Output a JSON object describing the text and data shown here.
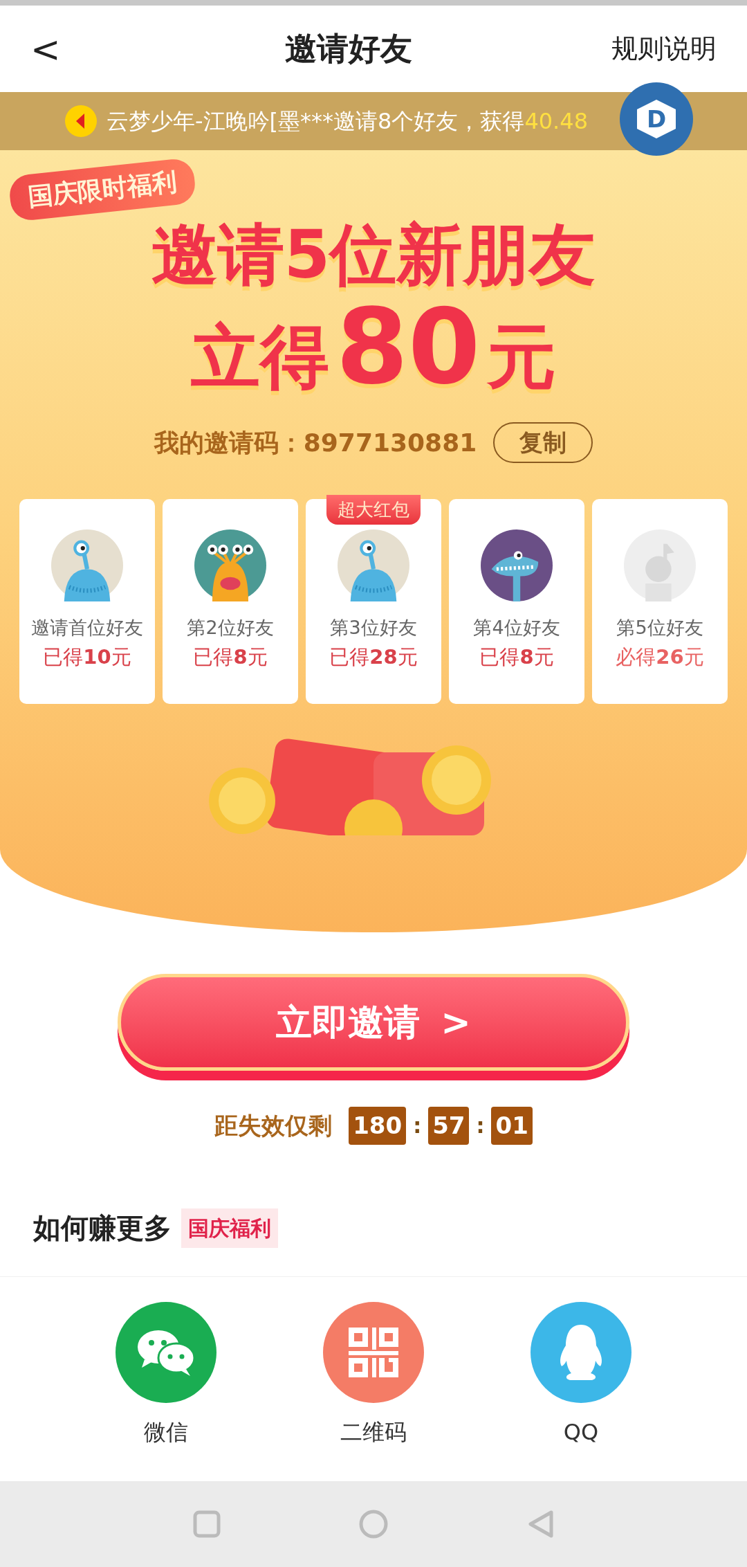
{
  "header": {
    "back": "<",
    "title": "邀请好友",
    "rules": "规则说明"
  },
  "ticker": {
    "text": "云梦少年-江晚吟[墨***邀请8个好友，获得",
    "amount": "40.48",
    "badge": "D"
  },
  "hero": {
    "tag": "国庆限时福利",
    "line1": "邀请5位新朋友",
    "line2_prefix": "立得",
    "line2_number": "80",
    "line2_suffix": "元",
    "code_label": "我的邀请码：",
    "code": "8977130881",
    "copy": "复制"
  },
  "friends": [
    {
      "label": "邀请首位好友",
      "reward": "已得**10**元",
      "claimed": true,
      "kind": "one-eye"
    },
    {
      "label": "第2位好友",
      "reward": "已得**8**元",
      "claimed": true,
      "kind": "many-eyes"
    },
    {
      "label": "第3位好友",
      "reward": "已得**28**元",
      "claimed": true,
      "kind": "one-eye",
      "badge": "超大红包"
    },
    {
      "label": "第4位好友",
      "reward": "已得**8**元",
      "claimed": true,
      "kind": "shark"
    },
    {
      "label": "第5位好友",
      "reward": "必得**26**元",
      "claimed": false,
      "kind": "placeholder"
    }
  ],
  "invite_button": {
    "label": "立即邀请",
    "arrow": ">"
  },
  "countdown": {
    "label": "距失效仅剩",
    "segments": [
      "180",
      "57",
      "01"
    ],
    "separator": ":"
  },
  "section": {
    "title": "如何赚更多",
    "tag": "国庆福利"
  },
  "share": [
    {
      "label": "微信",
      "kind": "wechat"
    },
    {
      "label": "二维码",
      "kind": "qrcode"
    },
    {
      "label": "QQ",
      "kind": "qq"
    }
  ]
}
